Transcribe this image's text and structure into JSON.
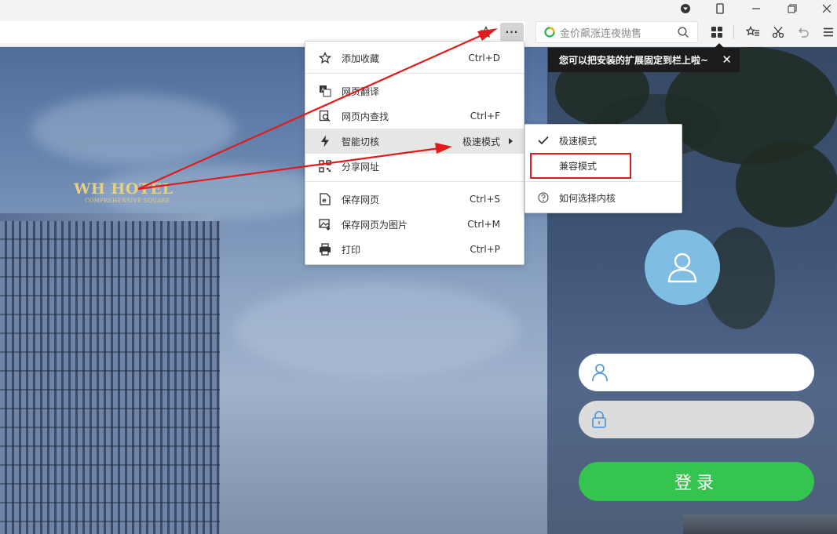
{
  "browser": {
    "search_placeholder": "金价飙涨连夜抛售",
    "more_button": "···"
  },
  "tooltip": {
    "text": "您可以把安装的扩展固定到栏上啦~",
    "close": "✕"
  },
  "menu": {
    "items": [
      {
        "label": "添加收藏",
        "shortcut": "Ctrl+D",
        "icon": "star-icon"
      },
      {
        "label": "网页翻译",
        "shortcut": "",
        "icon": "translate-icon"
      },
      {
        "label": "网页内查找",
        "shortcut": "Ctrl+F",
        "icon": "find-icon"
      },
      {
        "label": "智能切核",
        "submenu_value": "极速模式",
        "icon": "lightning-icon"
      },
      {
        "label": "分享网址",
        "shortcut": "",
        "icon": "qrcode-icon"
      },
      {
        "label": "保存网页",
        "shortcut": "Ctrl+S",
        "icon": "save-page-icon"
      },
      {
        "label": "保存网页为图片",
        "shortcut": "Ctrl+M",
        "icon": "save-image-icon"
      },
      {
        "label": "打印",
        "shortcut": "Ctrl+P",
        "icon": "printer-icon"
      }
    ]
  },
  "submenu": {
    "items": [
      {
        "label": "极速模式",
        "checked": true
      },
      {
        "label": "兼容模式",
        "checked": false
      },
      {
        "label": "如何选择内核",
        "icon": "help-icon"
      }
    ]
  },
  "page": {
    "hotel_name": "WH HOTEL",
    "hotel_subtitle": "COMPREHENSIVE SQUARE",
    "login_button": "登录"
  },
  "colors": {
    "login_green": "#35c44f",
    "avatar_blue": "#7fbde2",
    "annotation_red": "#e01b1b"
  }
}
